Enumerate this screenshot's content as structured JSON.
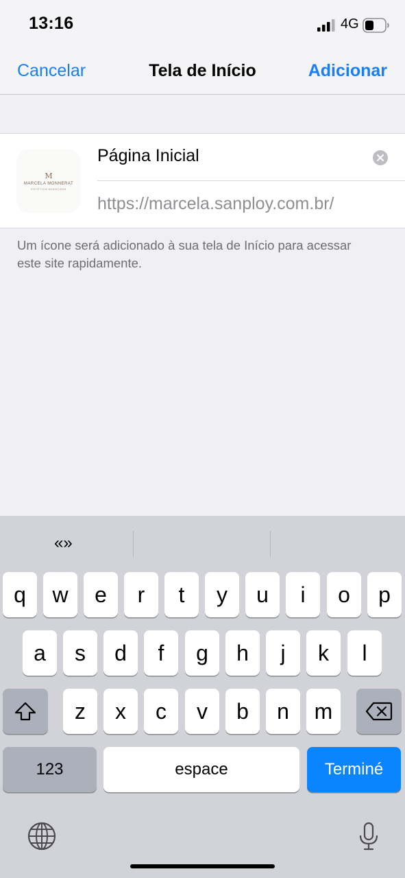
{
  "status_bar": {
    "time": "13:16",
    "network": "4G",
    "icons": [
      "signal-icon",
      "battery-icon"
    ]
  },
  "nav": {
    "cancel_label": "Cancelar",
    "title": "Tela de Início",
    "add_label": "Adicionar"
  },
  "form": {
    "name_value": "Página Inicial",
    "url": "https://marcela.sanploy.com.br/",
    "icon_logo": {
      "mark": "M",
      "name": "MARCELA MONNERAT",
      "tagline": "ESTÉTICA AVANÇADA"
    },
    "clear_icon": "clear-circle-icon"
  },
  "hint": "Um ícone será adicionado à sua tela de Início para acessar este site rapidamente.",
  "keyboard": {
    "suggestion": "«»",
    "row1": [
      "q",
      "w",
      "e",
      "r",
      "t",
      "y",
      "u",
      "i",
      "o",
      "p"
    ],
    "row2": [
      "a",
      "s",
      "d",
      "f",
      "g",
      "h",
      "j",
      "k",
      "l"
    ],
    "row3": [
      "z",
      "x",
      "c",
      "v",
      "b",
      "n",
      "m"
    ],
    "numbers_label": "123",
    "space_label": "espace",
    "done_label": "Terminé",
    "icons": [
      "shift-icon",
      "backspace-icon",
      "globe-icon",
      "microphone-icon"
    ]
  },
  "colors": {
    "accent": "#1a7ff5",
    "done_key": "#0a84ff",
    "keyboard_bg": "#d1d3d9",
    "page_bg": "#efeff4"
  }
}
